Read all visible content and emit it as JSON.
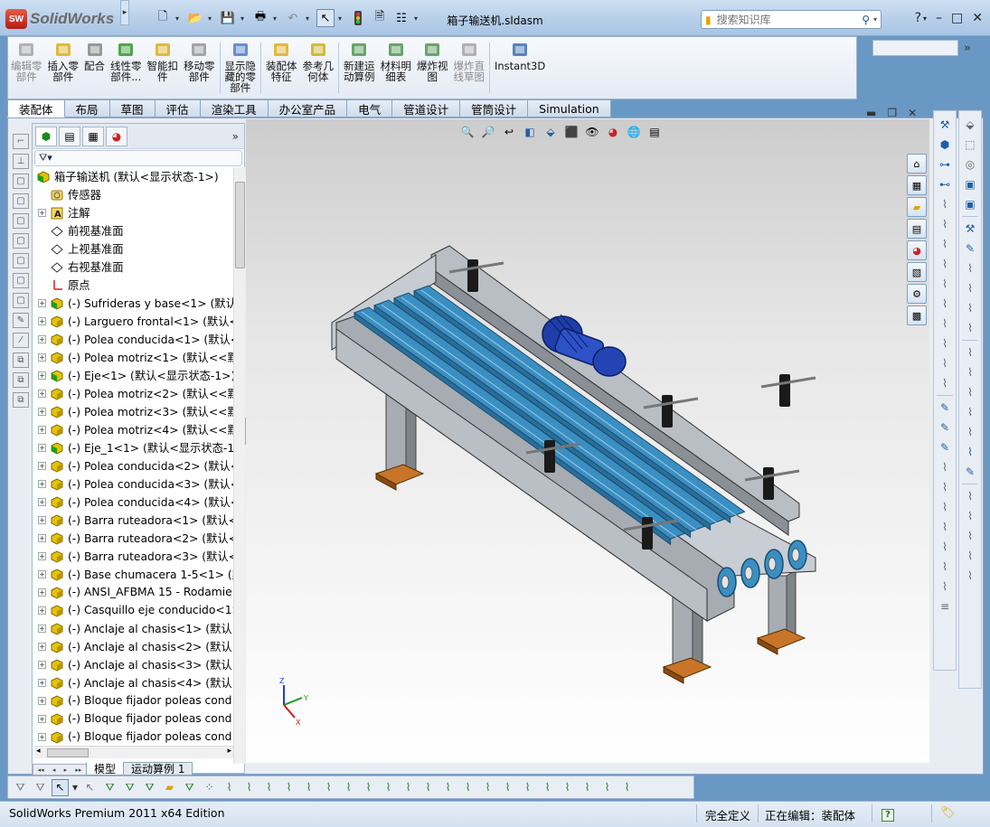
{
  "app": {
    "logo_badge": "SW",
    "logo_text": "SolidWorks",
    "doc_title": "箱子输送机.sldasm"
  },
  "search": {
    "placeholder": "搜索知识库"
  },
  "window_controls": {
    "help": "?",
    "minimize": "–",
    "maximize": "□",
    "close": "✕"
  },
  "ribbon": {
    "buttons": [
      {
        "label": "编辑零\n部件",
        "icon": "edit-component-icon",
        "enabled": false
      },
      {
        "label": "插入零\n部件",
        "icon": "insert-component-icon",
        "enabled": true
      },
      {
        "label": "配合",
        "icon": "mate-icon",
        "enabled": true
      },
      {
        "label": "线性零\n部件...",
        "icon": "linear-pattern-icon",
        "enabled": true
      },
      {
        "label": "智能扣\n件",
        "icon": "smart-fastener-icon",
        "enabled": true
      },
      {
        "label": "移动零\n部件",
        "icon": "move-component-icon",
        "enabled": true
      },
      {
        "label": "显示隐\n藏的零\n部件",
        "icon": "show-hidden-icon",
        "enabled": true
      },
      {
        "label": "装配体\n特征",
        "icon": "assembly-feature-icon",
        "enabled": true
      },
      {
        "label": "参考几\n何体",
        "icon": "reference-geometry-icon",
        "enabled": true
      },
      {
        "label": "新建运\n动算例",
        "icon": "motion-study-icon",
        "enabled": true
      },
      {
        "label": "材料明\n细表",
        "icon": "bom-icon",
        "enabled": true
      },
      {
        "label": "爆炸视\n图",
        "icon": "explode-view-icon",
        "enabled": true
      },
      {
        "label": "爆炸直\n线草图",
        "icon": "explode-line-icon",
        "enabled": false
      },
      {
        "label": "Instant3D",
        "icon": "instant3d-icon",
        "enabled": true
      }
    ]
  },
  "tabs": [
    "装配体",
    "布局",
    "草图",
    "评估",
    "渲染工具",
    "办公室产品",
    "电气",
    "管道设计",
    "管筒设计",
    "Simulation"
  ],
  "active_tab": "装配体",
  "tree": {
    "root": "箱子输送机 (默认<显示状态-1>)",
    "items": [
      {
        "label": "传感器",
        "icon": "sensor-icon",
        "expandable": false
      },
      {
        "label": "注解",
        "icon": "annotation-icon",
        "expandable": true
      },
      {
        "label": "前视基准面",
        "icon": "plane-icon",
        "expandable": false
      },
      {
        "label": "上视基准面",
        "icon": "plane-icon",
        "expandable": false
      },
      {
        "label": "右视基准面",
        "icon": "plane-icon",
        "expandable": false
      },
      {
        "label": "原点",
        "icon": "origin-icon",
        "expandable": false
      },
      {
        "label": "(-) Sufrideras y base<1> (默认",
        "icon": "subassembly-icon",
        "expandable": true
      },
      {
        "label": "(-) Larguero frontal<1> (默认<",
        "icon": "part-icon",
        "expandable": true
      },
      {
        "label": "(-) Polea conducida<1> (默认<",
        "icon": "part-icon",
        "expandable": true
      },
      {
        "label": "(-) Polea motriz<1> (默认<<默",
        "icon": "part-icon",
        "expandable": true
      },
      {
        "label": "(-) Eje<1> (默认<显示状态-1>)",
        "icon": "subassembly-icon",
        "expandable": true
      },
      {
        "label": "(-) Polea motriz<2> (默认<<默",
        "icon": "part-icon",
        "expandable": true
      },
      {
        "label": "(-) Polea motriz<3> (默认<<默",
        "icon": "part-icon",
        "expandable": true
      },
      {
        "label": "(-) Polea motriz<4> (默认<<默",
        "icon": "part-icon",
        "expandable": true
      },
      {
        "label": "(-) Eje_1<1> (默认<显示状态-1>",
        "icon": "subassembly-icon",
        "expandable": true
      },
      {
        "label": "(-) Polea conducida<2> (默认<",
        "icon": "part-icon",
        "expandable": true
      },
      {
        "label": "(-) Polea conducida<3> (默认<",
        "icon": "part-icon",
        "expandable": true
      },
      {
        "label": "(-) Polea conducida<4> (默认<",
        "icon": "part-icon",
        "expandable": true
      },
      {
        "label": "(-) Barra ruteadora<1> (默认<",
        "icon": "part-icon",
        "expandable": true
      },
      {
        "label": "(-) Barra ruteadora<2> (默认<",
        "icon": "part-icon",
        "expandable": true
      },
      {
        "label": "(-) Barra ruteadora<3> (默认<",
        "icon": "part-icon",
        "expandable": true
      },
      {
        "label": "(-) Base chumacera 1-5<1> (默",
        "icon": "part-icon",
        "expandable": true
      },
      {
        "label": "(-) ANSI_AFBMA 15 - Rodamie",
        "icon": "part-icon",
        "expandable": true
      },
      {
        "label": "(-) Casquillo eje conducido<1>",
        "icon": "part-icon",
        "expandable": true
      },
      {
        "label": "(-) Anclaje al chasis<1> (默认<",
        "icon": "part-icon",
        "expandable": true
      },
      {
        "label": "(-) Anclaje al chasis<2> (默认<",
        "icon": "part-icon",
        "expandable": true
      },
      {
        "label": "(-) Anclaje al chasis<3> (默认<",
        "icon": "part-icon",
        "expandable": true
      },
      {
        "label": "(-) Anclaje al chasis<4> (默认<",
        "icon": "part-icon",
        "expandable": true
      },
      {
        "label": "(-) Bloque fijador poleas cond",
        "icon": "part-icon",
        "expandable": true
      },
      {
        "label": "(-) Bloque fijador poleas cond",
        "icon": "part-icon",
        "expandable": true
      },
      {
        "label": "(-) Bloque fijador poleas cond",
        "icon": "part-icon",
        "expandable": true
      }
    ]
  },
  "bottom_tabs": [
    "模型",
    "运动算例 1"
  ],
  "active_bottom_tab": "模型",
  "status": {
    "edition": "SolidWorks Premium 2011 x64 Edition",
    "definition": "完全定义",
    "editing": "正在编辑：装配体",
    "help": "?"
  },
  "axes": {
    "x": "X",
    "y": "Y",
    "z": "Z"
  },
  "colors": {
    "belt": "#3a8fc2",
    "frame": "#9aa0a6",
    "motor": "#1f3ea8",
    "base_plate": "#c8752a",
    "bracket": "#1a1a1a"
  }
}
